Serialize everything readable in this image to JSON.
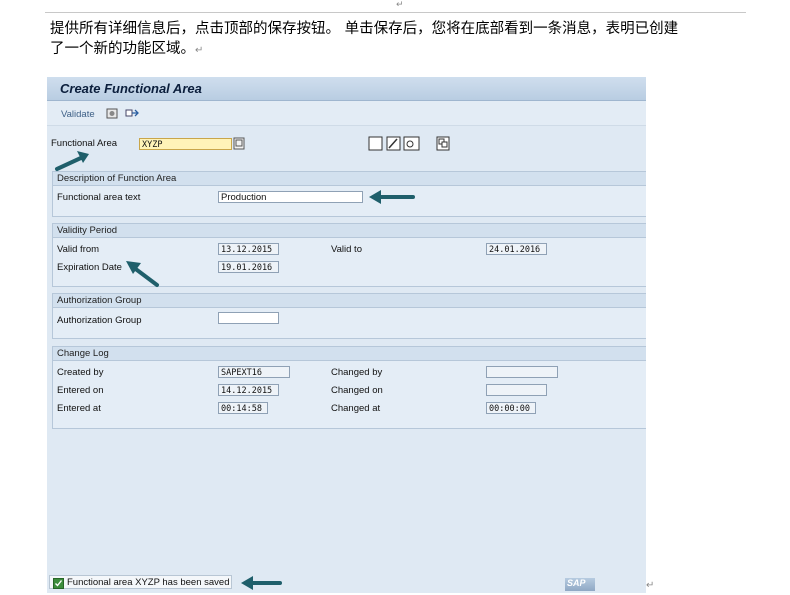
{
  "document": {
    "intro_line1": "提供所有详细信息后，点击顶部的保存按钮。 单击保存后，您将在底部看到一条消息，表明已创建",
    "intro_line2": "了一个新的功能区域。",
    "para_mark": "↵"
  },
  "window": {
    "title": "Create Functional Area"
  },
  "toolbar": {
    "validate_label": "Validate"
  },
  "header": {
    "functional_area_label": "Functional Area",
    "functional_area_value": "XYZP"
  },
  "description_group": {
    "title": "Description of Function Area",
    "text_label": "Functional area text",
    "text_value": "Production"
  },
  "validity_group": {
    "title": "Validity Period",
    "valid_from_label": "Valid from",
    "valid_from_value": "13.12.2015",
    "valid_to_label": "Valid to",
    "valid_to_value": "24.01.2016",
    "expiration_label": "Expiration Date",
    "expiration_value": "19.01.2016"
  },
  "authorization_group": {
    "title": "Authorization Group",
    "label": "Authorization Group",
    "value": ""
  },
  "change_log": {
    "title": "Change Log",
    "created_by_label": "Created by",
    "created_by_value": "SAPEXT16",
    "changed_by_label": "Changed by",
    "changed_by_value": "",
    "entered_on_label": "Entered on",
    "entered_on_value": "14.12.2015",
    "changed_on_label": "Changed on",
    "changed_on_value": "",
    "entered_at_label": "Entered at",
    "entered_at_value": "00:14:58",
    "changed_at_label": "Changed at",
    "changed_at_value": "00:00:00"
  },
  "status_bar": {
    "message": "Functional area XYZP has been saved",
    "logo_text": "SAP"
  },
  "colors": {
    "arrow": "#1f5f6b",
    "title": "#0b1e3c",
    "group_header": "#d2e0ee"
  }
}
